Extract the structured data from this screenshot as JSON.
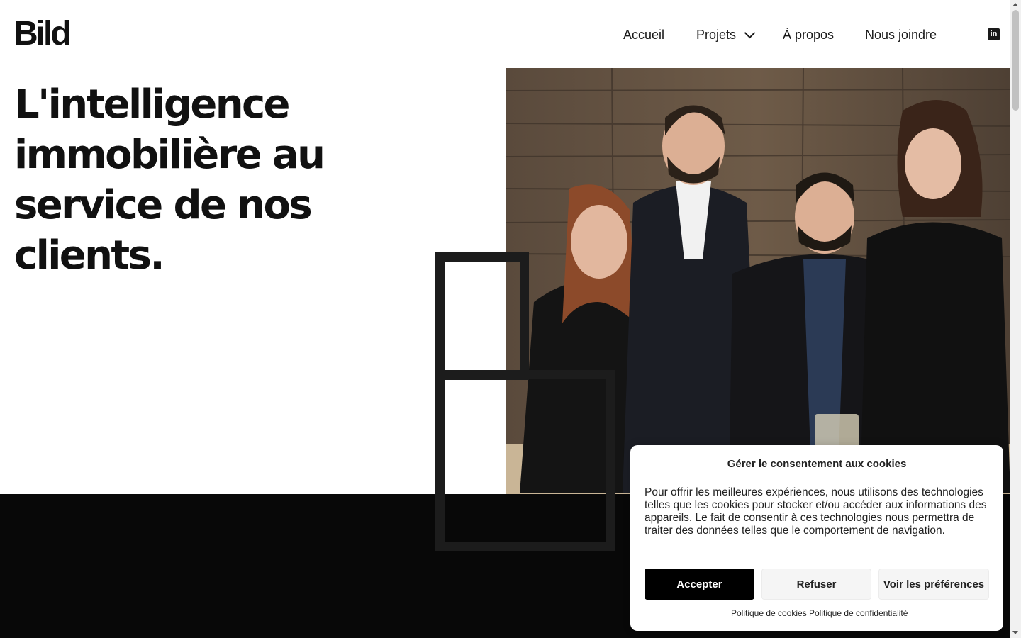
{
  "header": {
    "logo": "Bild",
    "nav": [
      {
        "label": "Accueil"
      },
      {
        "label": "Projets"
      },
      {
        "label": "À propos"
      },
      {
        "label": "Nous joindre"
      }
    ],
    "social_icon": "linkedin-icon",
    "social_icon_text": "in"
  },
  "hero": {
    "headline_lines": [
      "L'intelligence",
      "immobilière au",
      "service de nos clients."
    ]
  },
  "cookie_banner": {
    "title": "Gérer le consentement aux cookies",
    "text": "Pour offrir les meilleures expériences, nous utilisons des technologies telles que les cookies pour stocker et/ou accéder aux informations des appareils. Le fait de consentir à ces technologies nous permettra de traiter des données telles que le comportement de navigation.",
    "accept_label": "Accepter",
    "refuse_label": "Refuser",
    "prefs_label": "Voir les préférences",
    "cookie_policy_link": "Politique de cookies",
    "privacy_policy_link": "Politique de confidentialité"
  },
  "colors": {
    "dark_band": "#080808",
    "accent_black": "#000000",
    "frame": "#1c1c1c"
  }
}
